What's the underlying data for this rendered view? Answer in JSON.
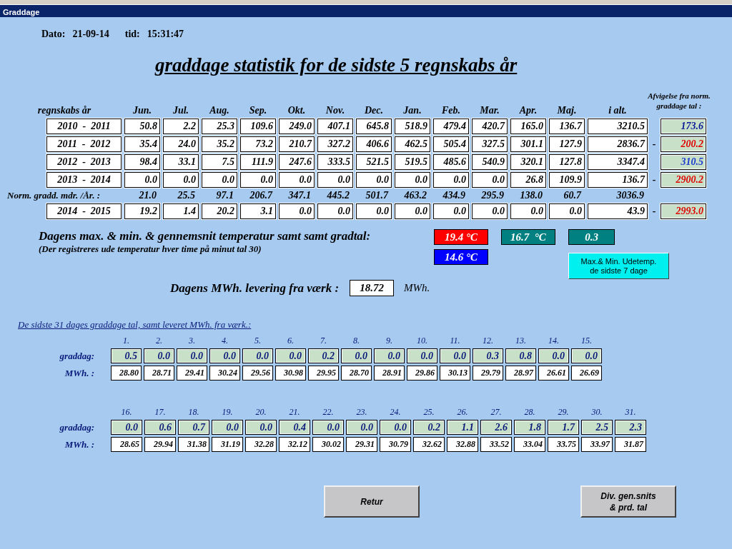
{
  "window": {
    "title": "Graddage"
  },
  "date_label": "Dato:",
  "date": "21-09-14",
  "time_label": "tid:",
  "time": "15:31:47",
  "heading": "graddage statistik for de sidste 5 regnskabs år",
  "table": {
    "columns": [
      "regnskabs år",
      "Jun.",
      "Jul.",
      "Aug.",
      "Sep.",
      "Okt.",
      "Nov.",
      "Dec.",
      "Jan.",
      "Feb.",
      "Mar.",
      "Apr.",
      "Maj.",
      "i alt."
    ],
    "deviation_header": "Afvigelse fra norm. graddage tal :",
    "rows": [
      {
        "kind": "year",
        "label": "2010  -  2011",
        "values": [
          "50.8",
          "2.2",
          "25.3",
          "109.6",
          "249.0",
          "407.1",
          "645.8",
          "518.9",
          "479.4",
          "420.7",
          "165.0",
          "136.7"
        ],
        "total": "3210.5",
        "deviation": {
          "value": "173.6",
          "color": "#0a1a9a"
        }
      },
      {
        "kind": "year",
        "label": "2011  -  2012",
        "values": [
          "35.4",
          "24.0",
          "35.2",
          "73.2",
          "210.7",
          "327.2",
          "406.6",
          "462.5",
          "505.4",
          "327.5",
          "301.1",
          "127.9"
        ],
        "total": "2836.7",
        "deviation": {
          "sign": "-",
          "value": "200.2",
          "color": "#e00000"
        }
      },
      {
        "kind": "year",
        "label": "2012  -  2013",
        "values": [
          "98.4",
          "33.1",
          "7.5",
          "111.9",
          "247.6",
          "333.5",
          "521.5",
          "519.5",
          "485.6",
          "540.9",
          "320.1",
          "127.8"
        ],
        "total": "3347.4",
        "deviation": {
          "value": "310.5",
          "color": "#1a3ad0"
        }
      },
      {
        "kind": "year",
        "label": "2013  -  2014",
        "values": [
          "0.0",
          "0.0",
          "0.0",
          "0.0",
          "0.0",
          "0.0",
          "0.0",
          "0.0",
          "0.0",
          "0.0",
          "26.8",
          "109.9"
        ],
        "total": "136.7",
        "deviation": {
          "sign": "-",
          "value": "2900.2",
          "color": "#e00000"
        }
      },
      {
        "kind": "norm",
        "label": "Norm. gradd. mdr. /År. :",
        "values": [
          "21.0",
          "25.5",
          "97.1",
          "206.7",
          "347.1",
          "445.2",
          "501.7",
          "463.2",
          "434.9",
          "295.9",
          "138.0",
          "60.7"
        ],
        "total": "3036.9"
      },
      {
        "kind": "year",
        "label": "2014  -  2015",
        "values": [
          "19.2",
          "1.4",
          "20.2",
          "3.1",
          "0.0",
          "0.0",
          "0.0",
          "0.0",
          "0.0",
          "0.0",
          "0.0",
          "0.0"
        ],
        "total": "43.9",
        "deviation": {
          "sign": "-",
          "value": "2993.0",
          "color": "#e00000"
        }
      }
    ]
  },
  "temperature": {
    "label": "Dagens max. & min. & gennemsnit temperatur samt samt gradtal:",
    "note": "(Der registreres ude temperatur hver time på minut tal 30)",
    "readings": [
      {
        "value": "19.4 °C",
        "color": "#ff0000"
      },
      {
        "value": "16.7  °C",
        "color": "#008080"
      },
      {
        "value": "0.3",
        "color": "#008080"
      },
      {
        "value": "14.6 °C",
        "color": "#0000ff"
      }
    ],
    "button_lines": [
      "Max.& Min. Udetemp.",
      "de sidste 7 dage"
    ]
  },
  "delivery": {
    "label": "Dagens MWh. levering fra værk :",
    "value": "18.72",
    "unit": "MWh."
  },
  "days_heading": "De sidste 31 dages graddage tal, samt leveret MWh. fra værk.:",
  "day_blocks": [
    {
      "graddag_label": "graddag:",
      "mwh_label": "MWh. :",
      "days": [
        {
          "day": "1.",
          "graddag": "0.5",
          "mwh": "28.80"
        },
        {
          "day": "2.",
          "graddag": "0.0",
          "mwh": "28.71"
        },
        {
          "day": "3.",
          "graddag": "0.0",
          "mwh": "29.41"
        },
        {
          "day": "4.",
          "graddag": "0.0",
          "mwh": "30.24"
        },
        {
          "day": "5.",
          "graddag": "0.0",
          "mwh": "29.56"
        },
        {
          "day": "6.",
          "graddag": "0.0",
          "mwh": "30.98"
        },
        {
          "day": "7.",
          "graddag": "0.2",
          "mwh": "29.95"
        },
        {
          "day": "8.",
          "graddag": "0.0",
          "mwh": "28.70"
        },
        {
          "day": "9.",
          "graddag": "0.0",
          "mwh": "28.91"
        },
        {
          "day": "10.",
          "graddag": "0.0",
          "mwh": "29.86"
        },
        {
          "day": "11.",
          "graddag": "0.0",
          "mwh": "30.13"
        },
        {
          "day": "12.",
          "graddag": "0.3",
          "mwh": "29.79"
        },
        {
          "day": "13.",
          "graddag": "0.8",
          "mwh": "28.97"
        },
        {
          "day": "14.",
          "graddag": "0.0",
          "mwh": "26.61"
        },
        {
          "day": "15.",
          "graddag": "0.0",
          "mwh": "26.69"
        }
      ]
    },
    {
      "graddag_label": "graddag:",
      "mwh_label": "MWh. :",
      "days": [
        {
          "day": "16.",
          "graddag": "0.0",
          "mwh": "28.65"
        },
        {
          "day": "17.",
          "graddag": "0.6",
          "mwh": "29.94"
        },
        {
          "day": "18.",
          "graddag": "0.7",
          "mwh": "31.38"
        },
        {
          "day": "19.",
          "graddag": "0.0",
          "mwh": "31.19"
        },
        {
          "day": "20.",
          "graddag": "0.0",
          "mwh": "32.28"
        },
        {
          "day": "21.",
          "graddag": "0.4",
          "mwh": "32.12"
        },
        {
          "day": "22.",
          "graddag": "0.0",
          "mwh": "30.02"
        },
        {
          "day": "23.",
          "graddag": "0.0",
          "mwh": "29.31"
        },
        {
          "day": "24.",
          "graddag": "0.0",
          "mwh": "30.79"
        },
        {
          "day": "25.",
          "graddag": "0.2",
          "mwh": "32.62"
        },
        {
          "day": "26.",
          "graddag": "1.1",
          "mwh": "32.88"
        },
        {
          "day": "27.",
          "graddag": "2.6",
          "mwh": "33.52"
        },
        {
          "day": "28.",
          "graddag": "1.8",
          "mwh": "33.04"
        },
        {
          "day": "29.",
          "graddag": "1.7",
          "mwh": "33.75"
        },
        {
          "day": "30.",
          "graddag": "2.5",
          "mwh": "33.97"
        },
        {
          "day": "31.",
          "graddag": "2.3",
          "mwh": "31.87"
        }
      ]
    }
  ],
  "buttons": [
    {
      "lines": [
        "Retur"
      ]
    },
    {
      "lines": [
        "Div. gen.snits",
        "& prd. tal"
      ]
    }
  ]
}
